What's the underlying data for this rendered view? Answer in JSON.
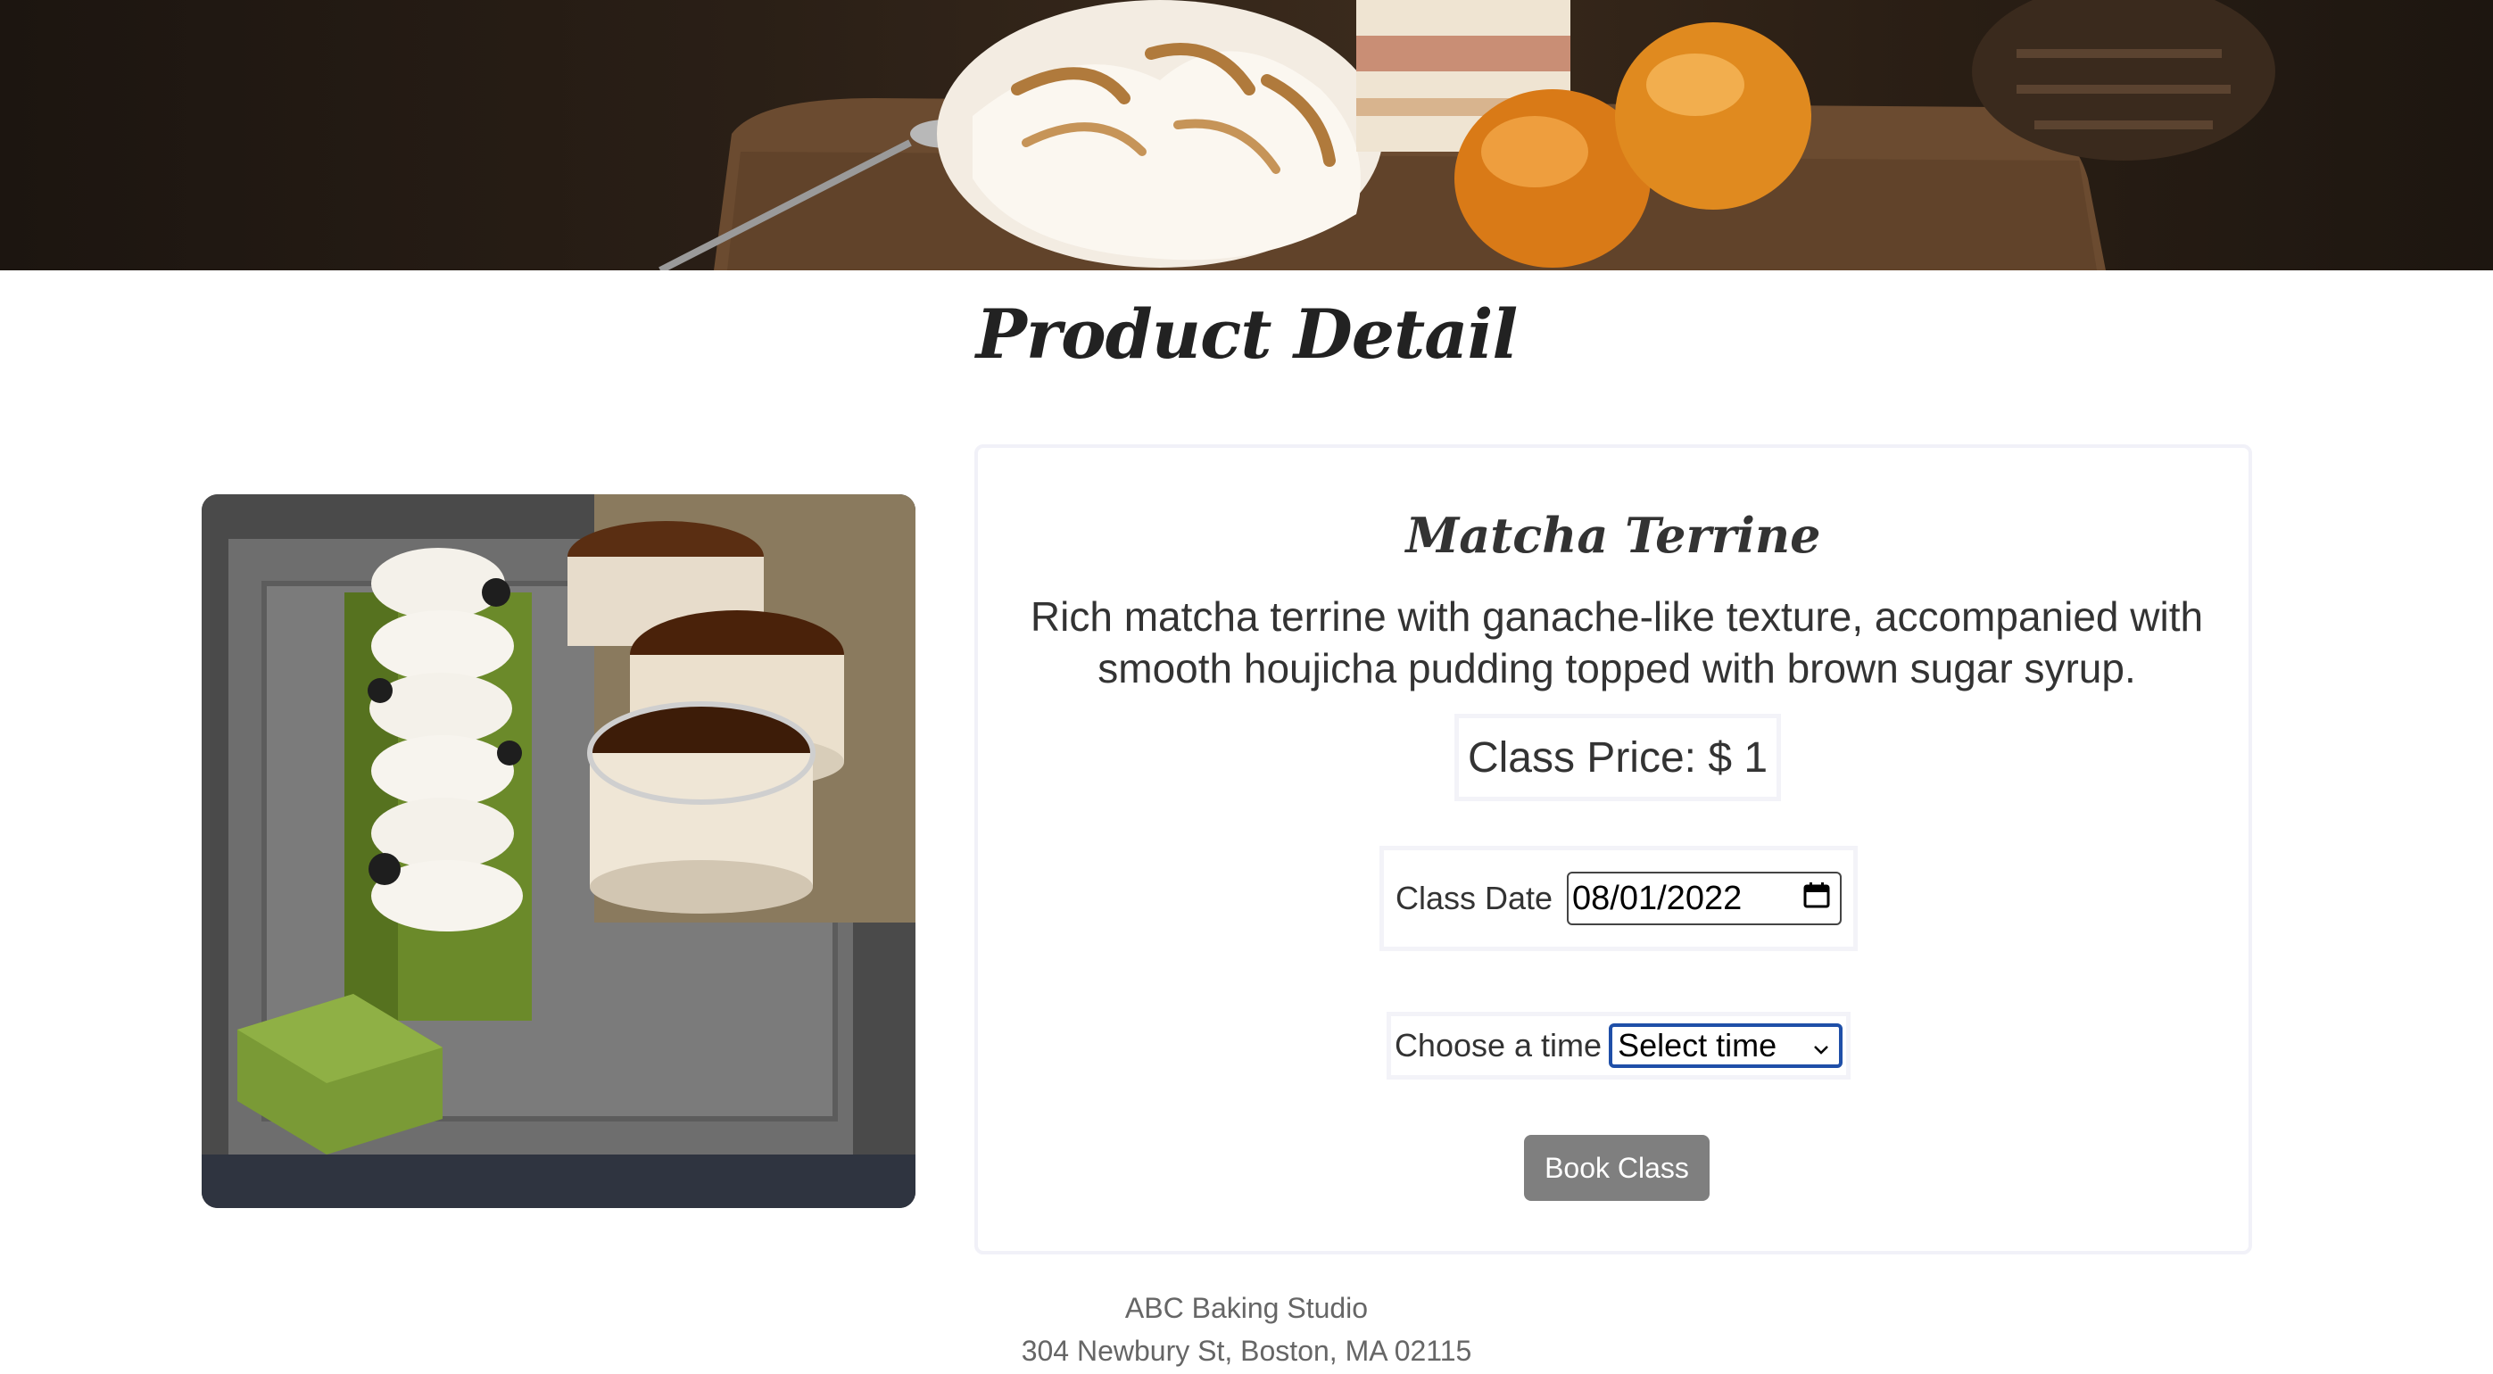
{
  "page": {
    "title": "Product Detail"
  },
  "product": {
    "name": "Matcha Terrine",
    "description": "Rich matcha terrine with ganache-like texture, accompanied with smooth houjicha pudding topped with brown sugar syrup.",
    "price_label": "Class Price: $ 1"
  },
  "booking": {
    "date_label": "Class Date",
    "date_value": "08/01/2022",
    "time_label": "Choose a time",
    "time_value": "Select time",
    "book_label": "Book Class"
  },
  "footer": {
    "studio": "ABC Baking Studio",
    "address": "304 Newbury St, Boston, MA 02115"
  },
  "icons": {
    "calendar": "calendar-icon",
    "dropdown": "chevron-down-icon"
  }
}
